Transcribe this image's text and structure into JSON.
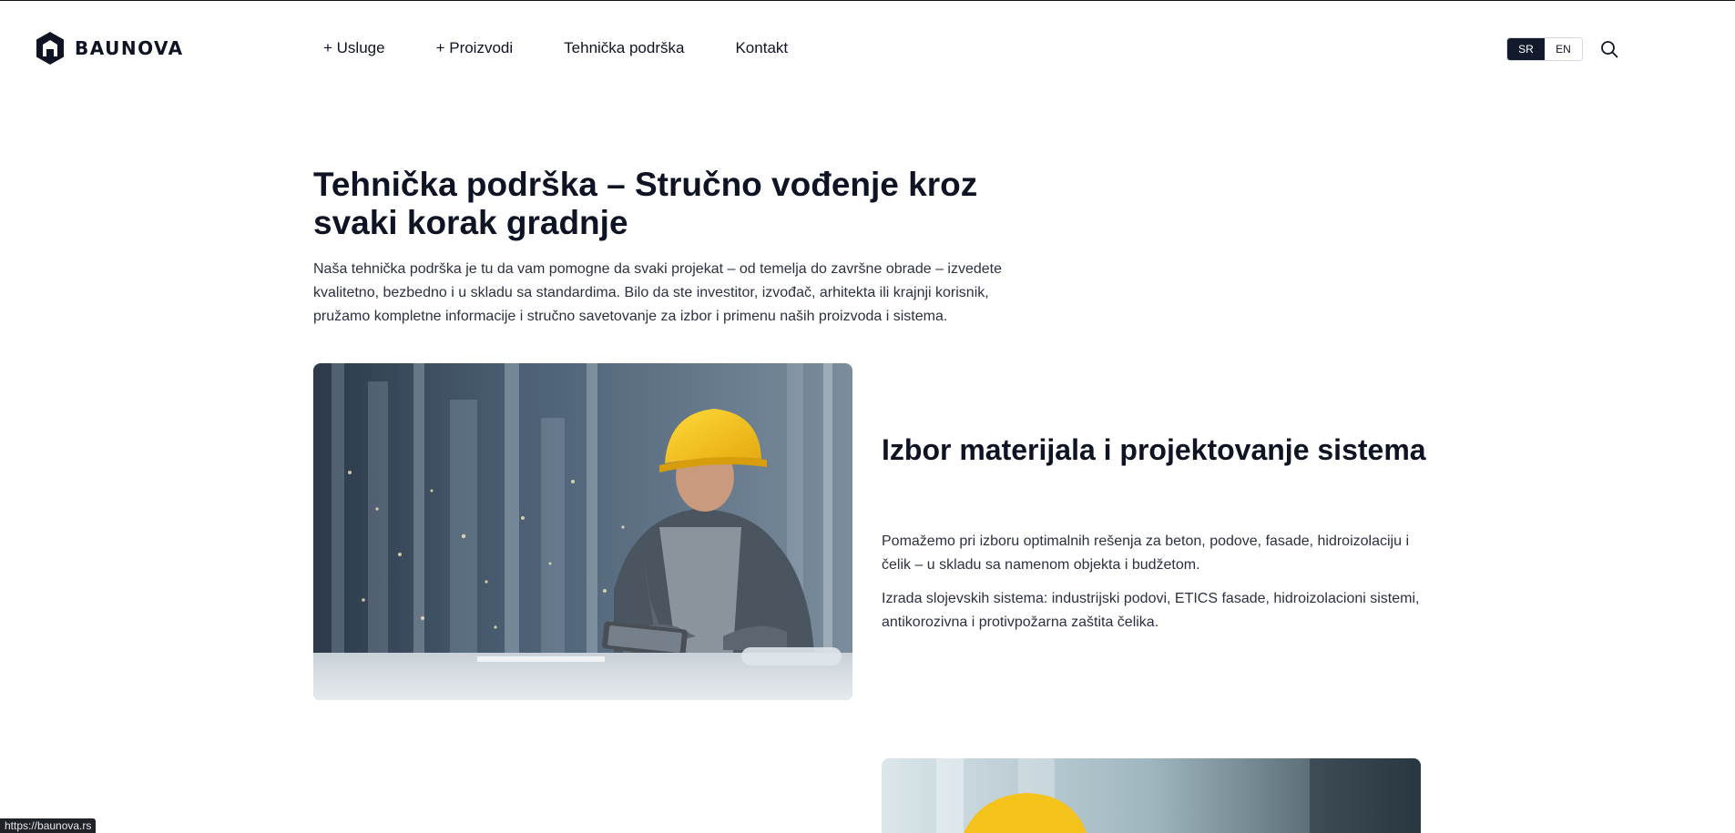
{
  "brand": {
    "name": "BAUNOVA",
    "logo_icon": "hexagon-house-icon"
  },
  "nav": {
    "items": [
      {
        "label": "+ Usluge"
      },
      {
        "label": "+ Proizvodi"
      },
      {
        "label": "Tehnička podrška"
      },
      {
        "label": "Kontakt"
      }
    ]
  },
  "language": {
    "options": [
      "SR",
      "EN"
    ],
    "selected": "SR"
  },
  "search": {
    "icon": "search-icon"
  },
  "hero": {
    "title": "Tehnička podrška – Stručno vođenje kroz svaki korak gradnje",
    "text": "Naša tehnička podrška je tu da vam pomogne da svaki projekat – od temelja do završne obrade – izvedete kvalitetno, bezbedno i u skladu sa standardima. Bilo da ste investitor, izvođač, arhitekta ili krajnji korisnik, pružamo kompletne informacije i stručno savetovanje za izbor i primenu naših proizvoda i sistema."
  },
  "feature": {
    "title": "Izbor materijala i projektovanje sistema",
    "paragraph1": "Pomažemo pri izboru optimalnih rešenja za beton, podove, fasade, hidroizolaciju i čelik – u skladu sa namenom objekta i budžetom.",
    "paragraph2": "Izrada slojevskih sistema: industrijski podovi, ETICS fasade, hidroizolacioni sistemi, antikorozivna i protivpožarna zaštita čelika."
  },
  "colors": {
    "text": "#0f1424",
    "accent_dark": "#121a2e",
    "helmet_yellow": "#f3c21b"
  },
  "status_bar": {
    "url": "https://baunova.rs"
  }
}
